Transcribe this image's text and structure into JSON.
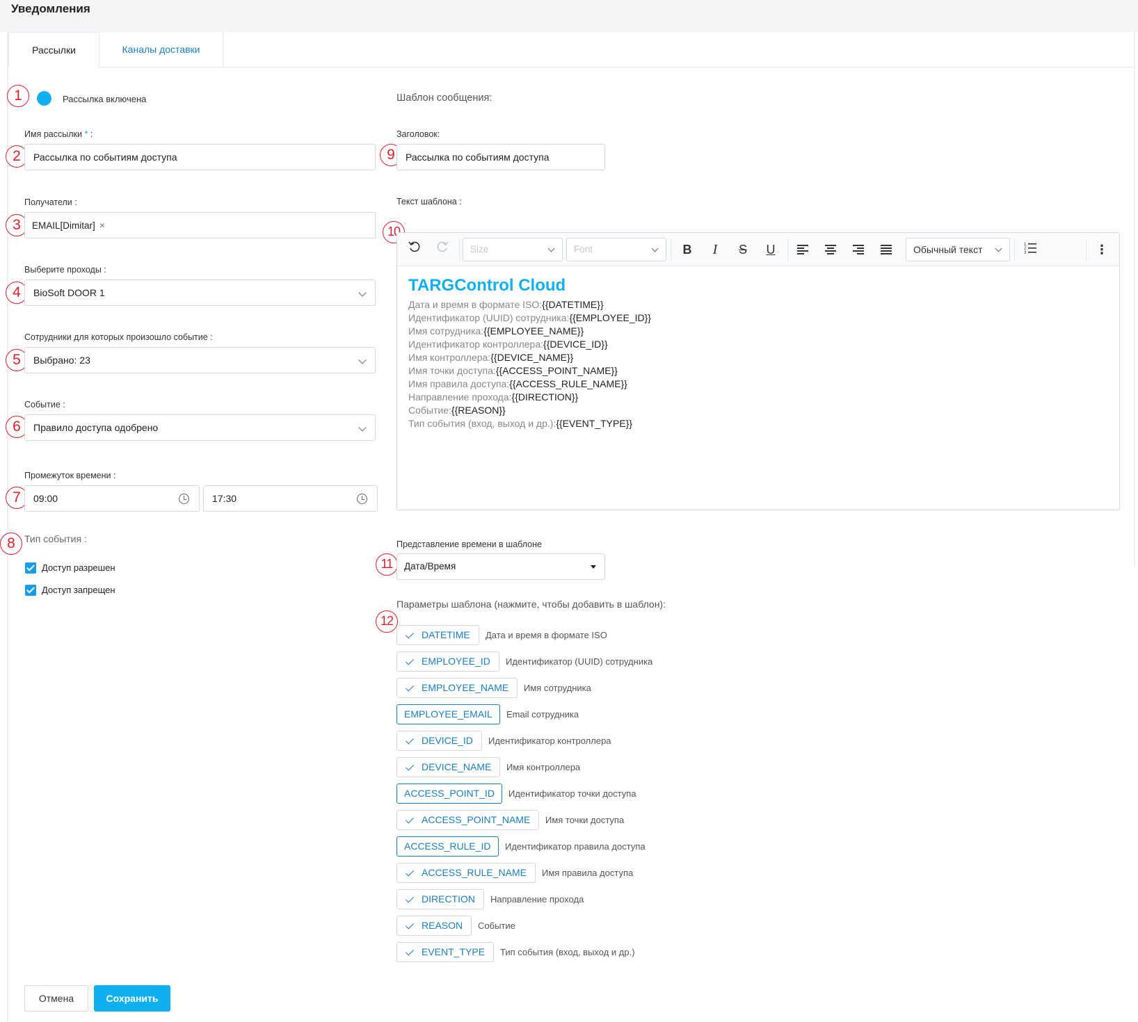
{
  "page": {
    "title": "Уведомления"
  },
  "tabs": [
    {
      "label": "Рассылки"
    },
    {
      "label": "Каналы доставки"
    }
  ],
  "markers": [
    "1",
    "2",
    "3",
    "4",
    "5",
    "6",
    "7",
    "8",
    "9",
    "10",
    "11",
    "12"
  ],
  "left": {
    "toggle_label": "Рассылка включена",
    "name": {
      "label": "Имя рассылки",
      "required_mark": "*",
      "suffix": " :",
      "value": "Рассылка по событиям доступа"
    },
    "recipients": {
      "label": "Получатели :",
      "chip": "EMAIL[Dimitar]",
      "chip_remove": "×"
    },
    "passages": {
      "label": "Выберите проходы :",
      "value": "BioSoft DOOR 1"
    },
    "employees": {
      "label": "Сотрудники для которых произошло событие :",
      "value": "Выбрано: 23"
    },
    "event": {
      "label": "Событие :",
      "value": "Правило доступа одобрено"
    },
    "time_range": {
      "label": "Промежуток времени :",
      "from": "09:00",
      "to": "17:30"
    },
    "event_type": {
      "label": "Тип события :",
      "options": [
        {
          "label": "Доступ разрешен",
          "checked": true
        },
        {
          "label": "Доступ запрещен",
          "checked": true
        }
      ]
    }
  },
  "right": {
    "template_section_title": "Шаблон сообщения:",
    "heading": {
      "label": "Заголовок:",
      "value": "Рассылка по событиям доступа"
    },
    "body_label": "Текст шаблона :",
    "toolbar": {
      "size_placeholder": "Size",
      "font_placeholder": "Font",
      "bold": "B",
      "italic": "I",
      "strike": "S",
      "underline": "U",
      "block_style": "Обычный текст",
      "more": "⋮"
    },
    "editor": {
      "heading": "TARGControl Cloud",
      "lines": [
        {
          "k": "Дата и время в формате ISO:",
          "v": "{{DATETIME}}"
        },
        {
          "k": "Идентификатор (UUID) сотрудника:",
          "v": "{{EMPLOYEE_ID}}"
        },
        {
          "k": "Имя сотрудника:",
          "v": "{{EMPLOYEE_NAME}}"
        },
        {
          "k": "Идентификатор контроллера:",
          "v": "{{DEVICE_ID}}"
        },
        {
          "k": "Имя контроллера:",
          "v": "{{DEVICE_NAME}}"
        },
        {
          "k": "Имя точки доступа:",
          "v": "{{ACCESS_POINT_NAME}}"
        },
        {
          "k": "Имя правила доступа:",
          "v": "{{ACCESS_RULE_NAME}}"
        },
        {
          "k": "Направление прохода:",
          "v": "{{DIRECTION}}"
        },
        {
          "k": "Событие:",
          "v": "{{REASON}}"
        },
        {
          "k": "Тип события (вход, выход и др.):",
          "v": "{{EVENT_TYPE}}"
        }
      ]
    },
    "time_format": {
      "label": "Представление времени в шаблоне",
      "value": "Дата/Время"
    },
    "params_title": "Параметры шаблона (нажмите, чтобы добавить в шаблон):",
    "params": [
      {
        "key": "DATETIME",
        "desc": "Дата и время в формате ISO",
        "checked": true
      },
      {
        "key": "EMPLOYEE_ID",
        "desc": "Идентификатор (UUID) сотрудника",
        "checked": true
      },
      {
        "key": "EMPLOYEE_NAME",
        "desc": "Имя сотрудника",
        "checked": true
      },
      {
        "key": "EMPLOYEE_EMAIL",
        "desc": "Email сотрудника",
        "checked": false
      },
      {
        "key": "DEVICE_ID",
        "desc": "Идентификатор контроллера",
        "checked": true
      },
      {
        "key": "DEVICE_NAME",
        "desc": "Имя контроллера",
        "checked": true
      },
      {
        "key": "ACCESS_POINT_ID",
        "desc": "Идентификатор точки доступа",
        "checked": false
      },
      {
        "key": "ACCESS_POINT_NAME",
        "desc": "Имя точки доступа",
        "checked": true
      },
      {
        "key": "ACCESS_RULE_ID",
        "desc": "Идентификатор правила доступа",
        "checked": false
      },
      {
        "key": "ACCESS_RULE_NAME",
        "desc": "Имя правила доступа",
        "checked": true
      },
      {
        "key": "DIRECTION",
        "desc": "Направление прохода",
        "checked": true
      },
      {
        "key": "REASON",
        "desc": "Событие",
        "checked": true
      },
      {
        "key": "EVENT_TYPE",
        "desc": "Тип события (вход, выход и др.)",
        "checked": true
      }
    ]
  },
  "footer": {
    "cancel": "Отмена",
    "save": "Сохранить"
  },
  "colors": {
    "accent": "#10aff0",
    "link": "#1a7ec2",
    "marker": "#e0202a"
  }
}
